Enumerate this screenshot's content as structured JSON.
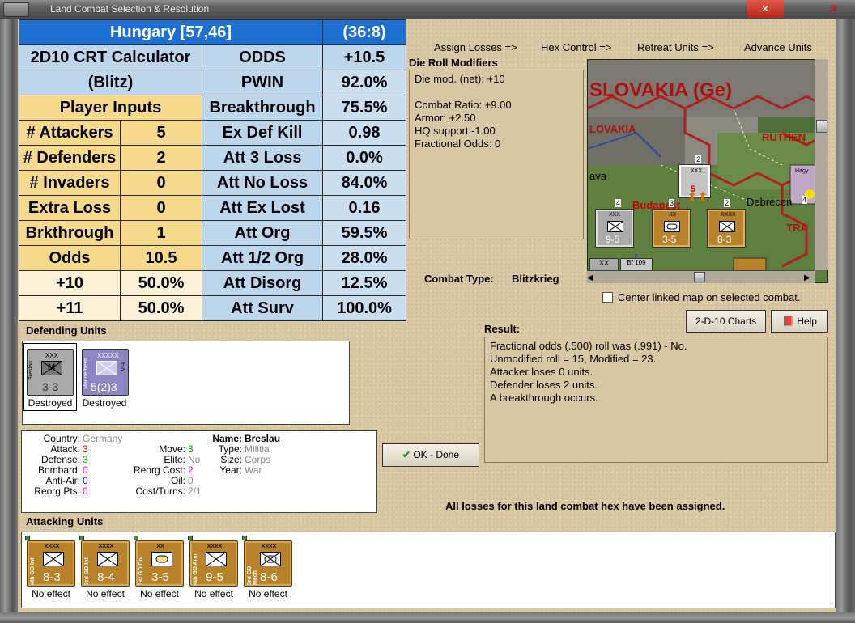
{
  "window": {
    "title": "Land Combat Selection & Resolution"
  },
  "crt": {
    "header_left": "Hungary [57,46]",
    "header_right": "(36:8)",
    "calc_title_1": "2D10 CRT Calculator",
    "calc_title_2": "(Blitz)",
    "player_inputs": "Player Inputs",
    "inputs": [
      {
        "label": "# Attackers",
        "value": "5"
      },
      {
        "label": "# Defenders",
        "value": "2"
      },
      {
        "label": "# Invaders",
        "value": "0"
      },
      {
        "label": "Extra Loss",
        "value": "0"
      },
      {
        "label": "Brkthrough",
        "value": "1"
      },
      {
        "label": "Odds",
        "value": "10.5"
      }
    ],
    "odds_rows": [
      {
        "label": "+10",
        "value": "50.0%"
      },
      {
        "label": "+11",
        "value": "50.0%"
      }
    ],
    "results": [
      {
        "label": "ODDS",
        "value": "+10.5"
      },
      {
        "label": "PWIN",
        "value": "92.0%"
      },
      {
        "label": "Breakthrough",
        "value": "75.5%"
      },
      {
        "label": "Ex Def Kill",
        "value": "0.98"
      },
      {
        "label": "Att 3 Loss",
        "value": "0.0%"
      },
      {
        "label": "Att No Loss",
        "value": "84.0%"
      },
      {
        "label": "Att Ex Lost",
        "value": "0.16"
      },
      {
        "label": "Att Org",
        "value": "59.5%"
      },
      {
        "label": "Att 1/2 Org",
        "value": "28.0%"
      },
      {
        "label": "Att Disorg",
        "value": "12.5%"
      },
      {
        "label": "Att Surv",
        "value": "100.0%"
      }
    ]
  },
  "nav": {
    "assign_losses": "Assign Losses =>",
    "hex_control": "Hex Control =>",
    "retreat_units": "Retreat Units =>",
    "advance_units": "Advance Units"
  },
  "die_roll": {
    "title": "Die Roll Modifiers",
    "lines": [
      "Die mod. (net): +10",
      "",
      "Combat Ratio: +9.00",
      "Armor: +2.50",
      "HQ support:-1.00",
      "Fractional Odds: 0"
    ]
  },
  "map": {
    "labels": [
      "SLOVAKIA (Ge)",
      "LOVAKIA",
      "RUTHEN",
      "ava",
      "Budapest",
      "Debrecen",
      "TRA",
      "Bf 109",
      "Hagy"
    ],
    "units": [
      {
        "name": "Breslau",
        "size": "XXX",
        "value": "5"
      },
      {
        "name": "2",
        "size": "XXX",
        "value": "9-5"
      },
      {
        "name": "",
        "size": "XX",
        "value": "3-5"
      },
      {
        "name": "",
        "size": "XXXX",
        "value": "8-3"
      }
    ],
    "stack_counts": [
      "2",
      "4",
      "3",
      "2",
      "4"
    ],
    "center_linked_label": "Center linked map on selected combat."
  },
  "combat_type": {
    "label": "Combat Type:",
    "value": "Blitzkrieg"
  },
  "buttons": {
    "charts": "2-D-10 Charts",
    "help": "Help",
    "ok": "OK - Done"
  },
  "result": {
    "title": "Result:",
    "lines": [
      "Fractional odds (.500) roll was (.991)  - No.",
      "Unmodified roll = 15, Modified = 23.",
      "Attacker loses 0 units.",
      "Defender loses 2 units.",
      "A breakthrough occurs."
    ]
  },
  "defending": {
    "title": "Defending Units",
    "units": [
      {
        "name": "Breslau",
        "size": "XXX",
        "symbol": "M",
        "value": "3-3",
        "status": "Destroyed",
        "color": "#aaaaaa"
      },
      {
        "name": "Mannerheim",
        "size": "XXXXX",
        "symbol": "FIN",
        "value": "5(2)3",
        "status": "Destroyed",
        "color": "#8b86c2"
      }
    ]
  },
  "unit_info": {
    "country_label": "Country:",
    "country": "Germany",
    "attack_label": "Attack:",
    "attack": "3",
    "defense_label": "Defense:",
    "defense": "3",
    "bombard_label": "Bombard:",
    "bombard": "0",
    "antiair_label": "Anti-Air:",
    "antiair": "0",
    "reorg_label": "Reorg Pts:",
    "reorg": "0",
    "move_label": "Move:",
    "move": "3",
    "elite_label": "Elite:",
    "elite": "No",
    "reorgcost_label": "Reorg Cost:",
    "reorgcost": "2",
    "oil_label": "Oil:",
    "oil": "0",
    "costturns_label": "Cost/Turns:",
    "costturns": "2/1",
    "name_label": "Name:",
    "name": "Breslau",
    "type_label": "Type:",
    "type": "Militia",
    "size_label": "Size:",
    "size": "Corps",
    "year_label": "Year:",
    "year": "War"
  },
  "losses_assigned": "All losses for this land combat hex have been assigned.",
  "attacking": {
    "title": "Attacking Units",
    "units": [
      {
        "name": "4th GD Inf",
        "size": "XXXX",
        "value": "8-3",
        "status": "No effect",
        "type": "infantry"
      },
      {
        "name": "3rd GD Inf",
        "size": "XXXX",
        "value": "8-4",
        "status": "No effect",
        "type": "infantry"
      },
      {
        "name": "1st GD Div",
        "size": "XX",
        "value": "3-5",
        "status": "No effect",
        "type": "armor"
      },
      {
        "name": "4th GD Arm",
        "size": "XXXX",
        "value": "9-5",
        "status": "No effect",
        "type": "infantry"
      },
      {
        "name": "3rd GD Mech",
        "size": "XXXX",
        "value": "8-6",
        "status": "No effect",
        "type": "mech"
      }
    ],
    "counter_color": "#b7822a"
  }
}
